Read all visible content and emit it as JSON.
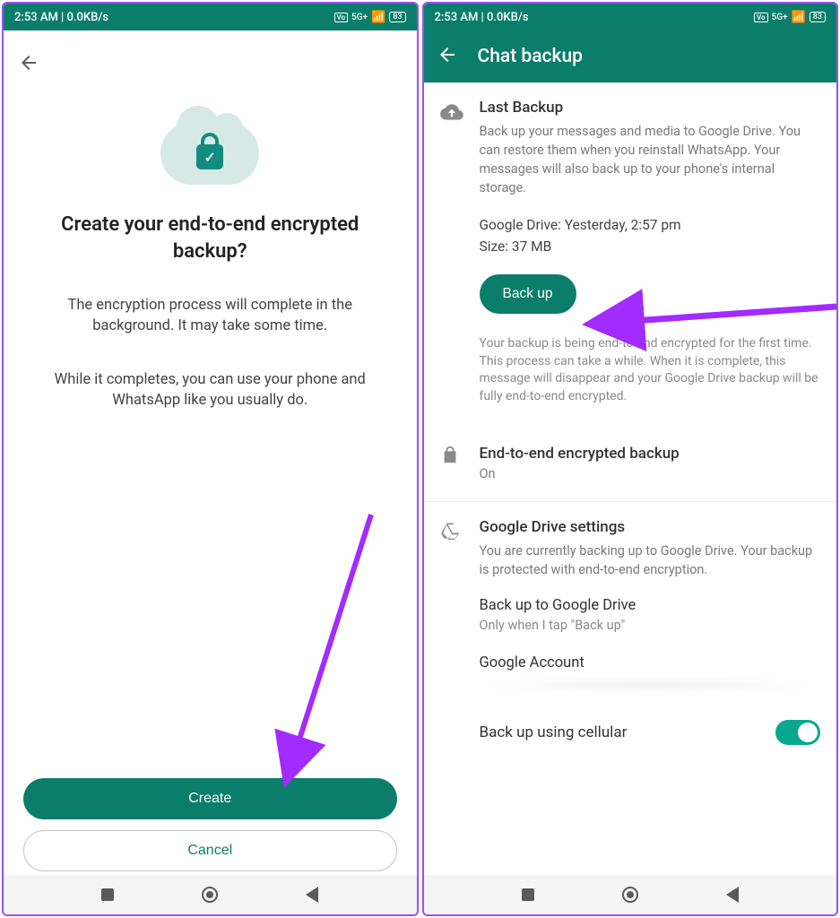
{
  "status": {
    "time_net": "2:53 AM | 0.0KB/s",
    "net_label": "5G+",
    "battery": "83"
  },
  "left": {
    "title": "Create your end-to-end encrypted backup?",
    "para1": "The encryption process will complete in the background. It may take some time.",
    "para2": "While it completes, you can use your phone and WhatsApp like you usually do.",
    "create": "Create",
    "cancel": "Cancel"
  },
  "right": {
    "title": "Chat backup",
    "last_backup": {
      "title": "Last Backup",
      "desc": "Back up your messages and media to Google Drive. You can restore them when you reinstall WhatsApp. Your messages will also back up to your phone's internal storage.",
      "drive_line": "Google Drive: Yesterday, 2:57 pm",
      "size_line": "Size: 37 MB",
      "button": "Back up",
      "note": "Your backup is being end-to-end encrypted for the first time. This process can take a while. When it is complete, this message will disappear and your Google Drive backup will be fully end-to-end encrypted."
    },
    "e2e": {
      "title": "End-to-end encrypted backup",
      "status": "On"
    },
    "gdrive": {
      "title": "Google Drive settings",
      "desc": "You are currently backing up to Google Drive. Your backup is protected with end-to-end encryption.",
      "opt1_t": "Back up to Google Drive",
      "opt1_s": "Only when I tap \"Back up\"",
      "opt2_t": "Google Account",
      "cellular": "Back up using cellular"
    }
  }
}
